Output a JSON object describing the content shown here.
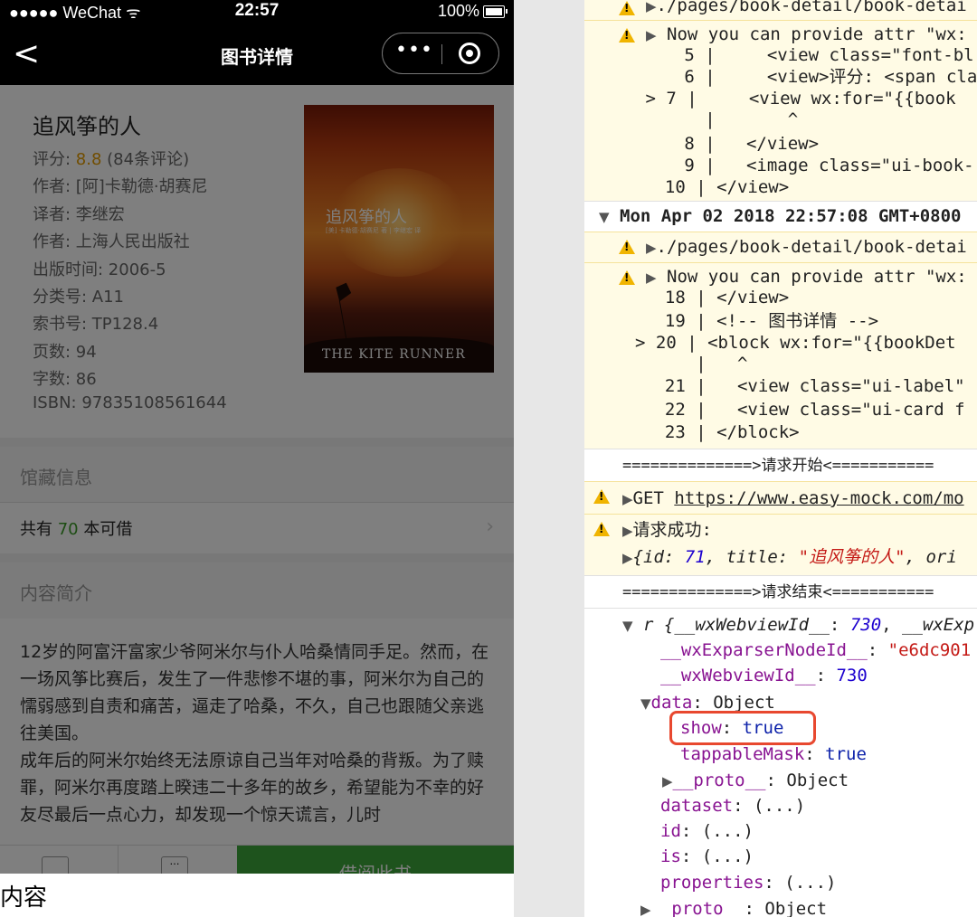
{
  "status_bar": {
    "carrier": "●●●●● WeChat",
    "time": "22:57",
    "battery": "100%"
  },
  "nav_bar": {
    "back": "<",
    "title": "图书详情",
    "more": "•••"
  },
  "book": {
    "title": "追风筝的人",
    "score_label": "评分: ",
    "score": "8.8",
    "comments": " (84条评论)",
    "author": "作者: [阿]卡勒德·胡赛尼",
    "translator": "译者: 李继宏",
    "publisher": "作者: 上海人民出版社",
    "publish_date": "出版时间: 2006-5",
    "category": "分类号: A11",
    "call_number": "索书号: TP128.4",
    "pages": "页数: 94",
    "words": "字数: 86",
    "isbn": "ISBN: 97835108561644",
    "cover_title": "追风筝的人",
    "cover_logo": "THE KITE RUNNER"
  },
  "holdings": {
    "header": "馆藏信息",
    "prefix": "共有 ",
    "count": "70",
    "suffix": " 本可借"
  },
  "intro": {
    "header": "内容简介",
    "p1": "12岁的阿富汗富家少爷阿米尔与仆人哈桑情同手足。然而，在一场风筝比赛后，发生了一件悲惨不堪的事，阿米尔为自己的懦弱感到自责和痛苦，逼走了哈桑，不久，自己也跟随父亲逃往美国。",
    "p2": "成年后的阿米尔始终无法原谅自己当年对哈桑的背叛。为了赎罪，阿米尔再度踏上暌违二十多年的故乡，希望能为不幸的好友尽最后一点心力，却发现一个惊天谎言，儿时"
  },
  "tab_bar": {
    "borrow": "借阅此书"
  },
  "popup": {
    "text": "内容"
  },
  "console": {
    "w1_path": "./pages/book-detail/book-detai",
    "w2_head": "Now you can provide attr \"wx:",
    "w2_l5": "   5 |     <view class=\"font-bl",
    "w2_l6": "   6 |     <view>评分: <span cla",
    "w2_l7": " > 7 |     <view wx:for=\"{{book",
    "w2_caret": "     |       ^",
    "w2_l8": "   8 |   </view>",
    "w2_l9": "   9 |   <image class=\"ui-book-",
    "w2_l10": "  10 | </view>",
    "date_group": "Mon Apr 02 2018 22:57:08 GMT+0800",
    "w3_path": "./pages/book-detail/book-detai",
    "w4_head": "Now you can provide attr \"wx:",
    "w4_l18": "  18 | </view>",
    "w4_l19": "  19 | <!-- 图书详情 -->",
    "w4_l20": "> 20 | <block wx:for=\"{{bookDet",
    "w4_caret": "     |   ^",
    "w4_l21": "  21 |   <view class=\"ui-label\"",
    "w4_l22": "  22 |   <view class=\"ui-card f",
    "w4_l23": "  23 | </block>",
    "req_start": "==============>请求开始<===========",
    "get_prefix": "GET ",
    "get_url": "https://www.easy-mock.com/mo",
    "req_ok": "请求成功:",
    "obj_open": "{",
    "obj_id_key": "id",
    "obj_id_val": "71",
    "obj_title_key": "title",
    "obj_title_val": "\"追风筝的人\"",
    "obj_tail": "ori",
    "req_end": "==============>请求结束<===========",
    "r_prefix": "r {",
    "r_k1": "__wxWebviewId__",
    "r_v1": "730",
    "r_k2": "__wxExp",
    "nodeid_key": "__wxExparserNodeId__",
    "nodeid_val": "\"e6dc901",
    "webviewid_key": "__wxWebviewId__",
    "webviewid_val": "730",
    "data_key": "data",
    "data_val": "Object",
    "show_key": "show",
    "show_val": "true",
    "tappable_key": "tappableMask",
    "tappable_val": "true",
    "proto1_key": "__proto__",
    "proto1_val": "Object",
    "dataset_key": "dataset",
    "id_key": "id",
    "is_key": "is",
    "properties_key": "properties",
    "lazy_val": "(...)",
    "proto2_key": "__proto__",
    "proto2_val": "Object"
  },
  "colors": {
    "warn_bg": "#fffbe5",
    "highlight_border": "#e8482f",
    "borrow_green": "#3da63a",
    "score_orange": "#e39b00"
  }
}
